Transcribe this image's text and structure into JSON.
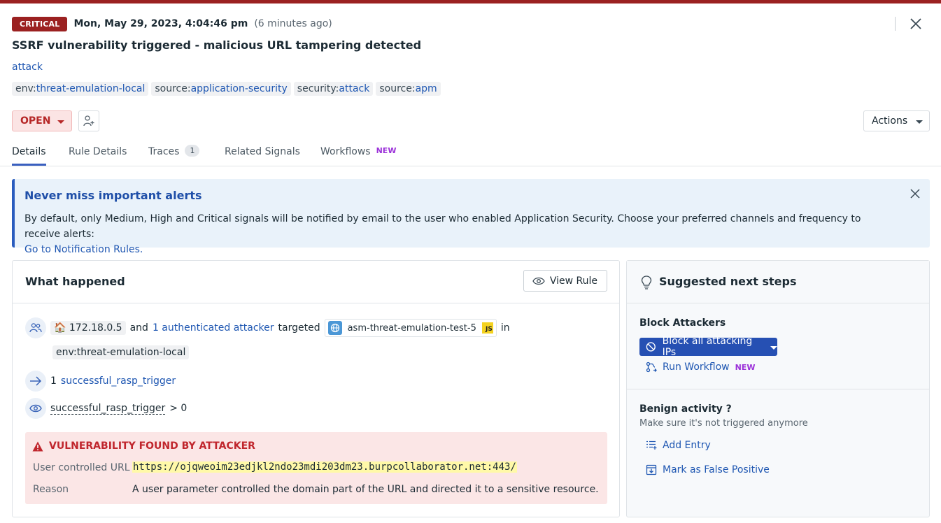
{
  "header": {
    "severity": "CRITICAL",
    "timestamp": "Mon, May 29, 2023, 4:04:46 pm",
    "relative_time": "(6 minutes ago)",
    "title": "SSRF vulnerability triggered - malicious URL tampering detected",
    "category": "attack",
    "tags": [
      {
        "key": "env:",
        "value": "threat-emulation-local"
      },
      {
        "key": "source:",
        "value": "application-security"
      },
      {
        "key": "security:",
        "value": "attack"
      },
      {
        "key": "source:",
        "value": "apm"
      }
    ],
    "status": "OPEN",
    "actions_label": "Actions"
  },
  "tabs": [
    {
      "label": "Details"
    },
    {
      "label": "Rule Details"
    },
    {
      "label": "Traces",
      "count": "1"
    },
    {
      "label": "Related Signals"
    },
    {
      "label": "Workflows",
      "badge": "NEW"
    }
  ],
  "banner": {
    "title": "Never miss important alerts",
    "text": "By default, only Medium, High and Critical signals will be notified by email to the user who enabled Application Security. Choose your preferred channels and frequency to receive alerts:",
    "link": "Go to Notification Rules."
  },
  "what_happened": {
    "title": "What happened",
    "view_rule": "View Rule",
    "attacker_ip": "172.18.0.5",
    "and": "and",
    "attackers_link": "1 authenticated attacker",
    "targeted": "targeted",
    "service": "asm-threat-emulation-test-5",
    "js_badge": "JS",
    "in": "in",
    "env_tag": "env:threat-emulation-local",
    "trigger_count": "1",
    "trigger_link": "successful_rasp_trigger",
    "condition_name": "successful_rasp_trigger",
    "condition_op": "> 0",
    "vulnerability": {
      "heading": "VULNERABILITY FOUND BY ATTACKER",
      "url_label": "User controlled URL",
      "url_value": "https://ojqweoim23edjkl2ndo23mdi203dm23.burpcollaborator.net:443/",
      "reason_label": "Reason",
      "reason_value": "A user parameter controlled the domain part of the URL and directed it to a sensitive resource."
    }
  },
  "next_steps": {
    "title": "Suggested next steps",
    "block_title": "Block Attackers",
    "block_button": "Block all attacking IPs",
    "run_workflow": "Run Workflow",
    "run_workflow_badge": "NEW",
    "benign_title": "Benign activity ?",
    "benign_sub": "Make sure it's not triggered anymore",
    "add_entry": "Add Entry",
    "false_positive": "Mark as False Positive"
  },
  "colors": {
    "critical": "#9b2121",
    "link": "#1f57b2",
    "primary_button": "#2650b3",
    "new_badge": "#9b30d9",
    "vuln_bg": "#fbe6e6"
  }
}
